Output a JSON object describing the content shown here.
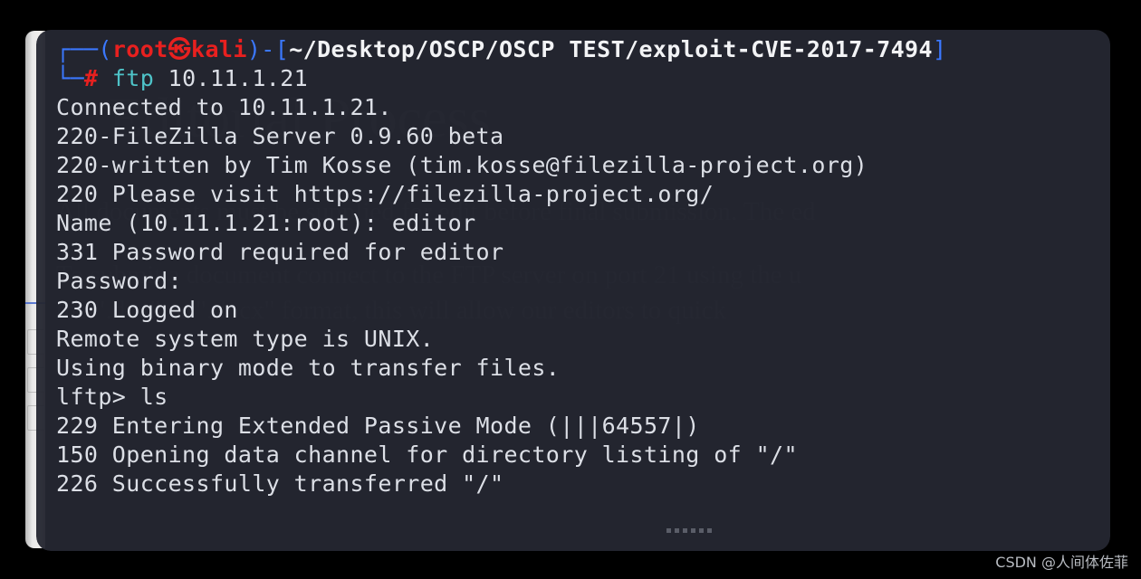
{
  "window": {
    "kind": "terminal-window",
    "background_color": "#252731",
    "page_background_color": "#000000"
  },
  "prompt": {
    "box_top": "┌──",
    "box_bottom": "└─",
    "paren_open": "(",
    "user": "root",
    "at_glyph": "㉿",
    "host": "kali",
    "paren_close": ")",
    "dash": "-",
    "bracket_open": "[",
    "path": "~/Desktop/OSCP/OSCP TEST/exploit-CVE-2017-7494",
    "bracket_close": "]",
    "hash": "#",
    "command_name": "ftp",
    "command_args": " 10.11.1.21"
  },
  "terminal_output": [
    "Connected to 10.11.1.21.",
    "220-FileZilla Server 0.9.60 beta",
    "220-written by Tim Kosse (tim.kosse@filezilla-project.org)",
    "220 Please visit https://filezilla-project.org/",
    "Name (10.11.1.21:root): editor",
    "331 Password required for editor",
    "Password:",
    "230 Logged on",
    "Remote system type is UNIX.",
    "Using binary mode to transfer files.",
    "lftp> ls",
    "229 Entering Extended Passive Mode (|||64557|)",
    "150 Opening data channel for directory listing of \"/\"",
    "226 Successfully transferred \"/\""
  ],
  "watermark": {
    "title": "Editorial Process",
    "paragraphs": [
      "All documents must be supplied for edit before final submission. The ed",
      "To submit a document connect to the FTP server on port 21 using the u",
      "the \".doc\" or \".docx\" format, this will allow our editors to quick"
    ]
  },
  "document_edge": {
    "fragments": [
      "s",
      "e",
      "y",
      "o",
      "if",
      "o)"
    ]
  },
  "resize_handle": {
    "dot_count": 6
  },
  "attribution": {
    "text": "CSDN @人间体佐菲"
  },
  "colors": {
    "terminal_bg": "#252731",
    "prompt_box": "#3b78ff",
    "prompt_user": "#e8201f",
    "prompt_path": "#f2f3f5",
    "command": "#4ec3c8",
    "output_text": "#dcdfe6",
    "watermark_text": "#2b2e37"
  }
}
